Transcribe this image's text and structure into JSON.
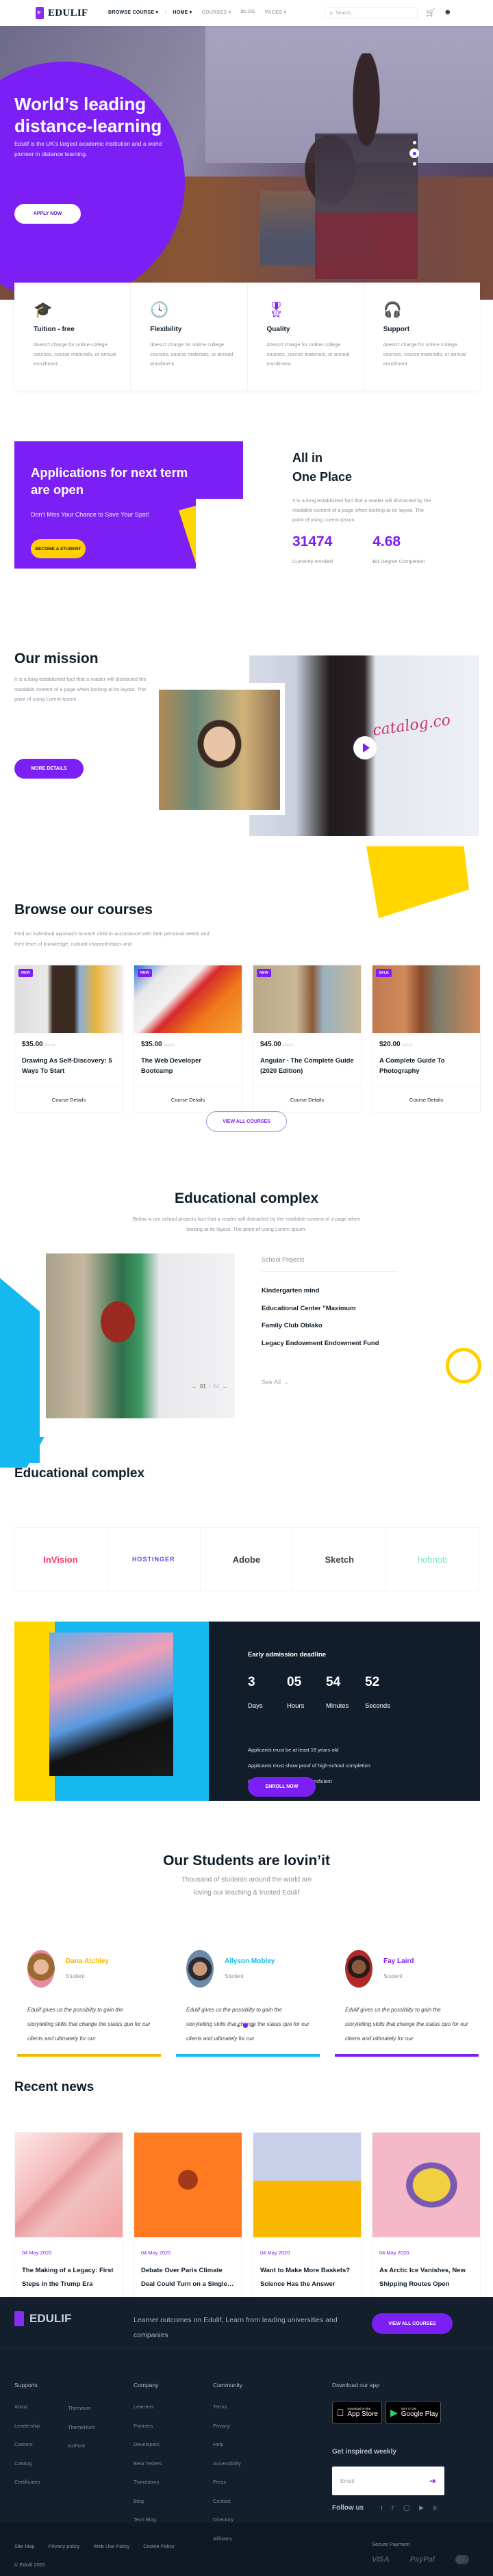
{
  "header": {
    "brand": "EDULIF",
    "nav": [
      {
        "label": "BROWSE COURSE ▾",
        "active": true
      },
      {
        "label": "HOME ▾",
        "active": true
      },
      {
        "label": "COURSES ▾",
        "active": false
      },
      {
        "label": "BLOG",
        "active": false
      },
      {
        "label": "PAGES ▾",
        "active": false
      }
    ],
    "search_placeholder": "Search..."
  },
  "hero": {
    "title": "World’s leading distance-learning",
    "subtitle": "Edulif is the UK’s largest academic institution and a world pioneer in distance learning.",
    "cta": "APPLY NOW",
    "slides_total": 3,
    "slide_active": 2
  },
  "features": [
    {
      "icon": "graduation-cap-icon",
      "title": "Tuition - free",
      "text": "doesn't charge for online college courses, course materials, or annual enrollment."
    },
    {
      "icon": "clock-icon",
      "title": "Flexibility",
      "text": "doesn't charge for online college courses, course materials, or annual enrollment."
    },
    {
      "icon": "award-ribbon-icon",
      "title": "Quality",
      "text": "doesn't charge for online college courses, course materials, or annual enrollment."
    },
    {
      "icon": "headset-icon",
      "title": "Support",
      "text": "doesn't charge for online college courses, course materials, or annual enrollment."
    }
  ],
  "applications": {
    "title": "Applications for next term are open",
    "subtitle": "Don't Miss Your Chance to Save Your Spot!",
    "cta": "BECOME A STUDENT"
  },
  "all_in_one": {
    "title_line1": "All in",
    "title_line2": "One Place",
    "text": "It is a long established fact that a reader will distracted by the readable content of a page when looking at its layout. The point of using Lorem Ipsum.",
    "stats": [
      {
        "value": "31474",
        "label": "Currently enrolled"
      },
      {
        "value": "4.68",
        "label": "BA Degree Completion"
      }
    ]
  },
  "mission": {
    "title": "Our mission",
    "text": "It is a long established fact that a reader will distracted the readable content of a page when looking at its layout. The point of using Lorem Ipsum.",
    "cta": "MORE DETAILS",
    "video_text": "catalog.co"
  },
  "courses": {
    "title": "Browse our courses",
    "subtitle": "Find an individual approach to each child in accordance with their personal needs and their level of knowledge, cultural characteristics and",
    "items": [
      {
        "badge": "NEW",
        "price": "$35.00",
        "old_price": "$40.00",
        "title": "Drawing As Self-Discovery: 5 Ways To Start",
        "details": "Course Details"
      },
      {
        "badge": "NEW",
        "price": "$35.00",
        "old_price": "$40.00",
        "title": "The Web Developer Bootcamp",
        "details": "Course Details"
      },
      {
        "badge": "NEW",
        "price": "$45.00",
        "old_price": "$50.00",
        "title": "Angular - The Complete Guide (2020 Edition)",
        "details": "Course Details"
      },
      {
        "badge": "SALE",
        "price": "$20.00",
        "old_price": "$44.00",
        "title": "A Complete Guide To Photography",
        "details": "Course Details"
      }
    ],
    "view_all": "VIEW ALL COURSES"
  },
  "edu_complex": {
    "title": "Educational complex",
    "subtitle": "Below is our school projects fact that a reader will distracted by the readable content of a page when looking at its layout. The point of using Lorem Ipsum.",
    "projects_heading": "School Projects",
    "projects": [
      "Kindergarten mind",
      "Educational Center \"Maximum",
      "Family Club Oblako",
      "Legacy Endowment Endowment Fund"
    ],
    "see_all": "See All →",
    "slide_current": "01",
    "slide_total": "04"
  },
  "partners": {
    "title": "Educational complex",
    "logos": [
      "InVision",
      "HOSTINGER",
      "Adobe",
      "Sketch",
      "hobnob"
    ]
  },
  "countdown": {
    "title": "Early admission deadline",
    "units": [
      {
        "value": "3",
        "label": "Days"
      },
      {
        "value": "05",
        "label": "Hours"
      },
      {
        "value": "54",
        "label": "Minutes"
      },
      {
        "value": "52",
        "label": "Seconds"
      }
    ],
    "requirements": [
      "Applicants must be at least 16 years old",
      "Applicants must show proof of high-school completion",
      "Applicants must be English proficient"
    ],
    "cta": "ENROLL NOW"
  },
  "testimonials": {
    "title": "Our Students are lovin’it",
    "subtitle_line1": "Thousand of students around the world are",
    "subtitle_line2": "loving our teaching & trusted Edulif",
    "items": [
      {
        "name": "Dana Atchley",
        "role": "Student",
        "quote": "Edulif gives us the possibilty to gain the storytelling skills that change the status quo for our clients and ultimately for our",
        "color": "#f5b800"
      },
      {
        "name": "Allyson Mobley",
        "role": "Student",
        "quote": "Edulif gives us the possibilty to gain the storytelling skills that change the status quo for our clients and ultimately for our",
        "color": "#15b8ef"
      },
      {
        "name": "Fay Laird",
        "role": "Student",
        "quote": "Edulif gives us the possibilty to gain the storytelling skills that change the status quo for our clients and ultimately for our",
        "color": "#7c1ff5"
      }
    ],
    "dots_total": 3,
    "dot_active": 2
  },
  "news": {
    "title": "Recent news",
    "items": [
      {
        "date": "04 May 2020",
        "title": "The Making of a Legacy: First Steps in the Trump Era"
      },
      {
        "date": "04 May 2020",
        "title": "Debate Over Paris Climate Deal Could Turn on a Single…"
      },
      {
        "date": "04 May 2020",
        "title": "Want to Make More Baskets? Science Has the Answer"
      },
      {
        "date": "04 May 2020",
        "title": "As Arctic Ice Vanishes, New Shipping Routes Open"
      }
    ]
  },
  "footer": {
    "brand": "EDULIF",
    "tagline": "Learner outcomes on Edulif, Learn from leading universities and companies",
    "cta": "VIEW ALL COURSES",
    "supports": {
      "title": "Supports",
      "col1": [
        "About",
        "Leadership",
        "Careers",
        "Catalog",
        "Certificates"
      ],
      "col2": [
        "Themeum",
        "ThemeHunt",
        "IcoFont"
      ]
    },
    "company": {
      "title": "Company",
      "links": [
        "Learners",
        "Partners",
        "Developers",
        "Beta Testers",
        "Translators",
        "Blog",
        "Tech Blog"
      ]
    },
    "community": {
      "title": "Community",
      "links": [
        "Terms",
        "Privacy",
        "Help",
        "Accessibility",
        "Press",
        "Contact",
        "Directory",
        "Affiliates"
      ]
    },
    "app": {
      "title": "Download our app",
      "appstore_small": "Download on the",
      "appstore": "App Store",
      "gplay_small": "GET IT ON",
      "gplay": "Google Play"
    },
    "newsletter": {
      "title": "Get inspired weekly",
      "placeholder": "Email"
    },
    "follow": "Follow us",
    "bottom_links": [
      "Site Map",
      "Privacy policy",
      "Web Use Policy",
      "Cookie Policy"
    ],
    "copyright": "© Edulif 2020",
    "secure": "Secure Payment",
    "payments": [
      "VISA",
      "PayPal"
    ]
  }
}
